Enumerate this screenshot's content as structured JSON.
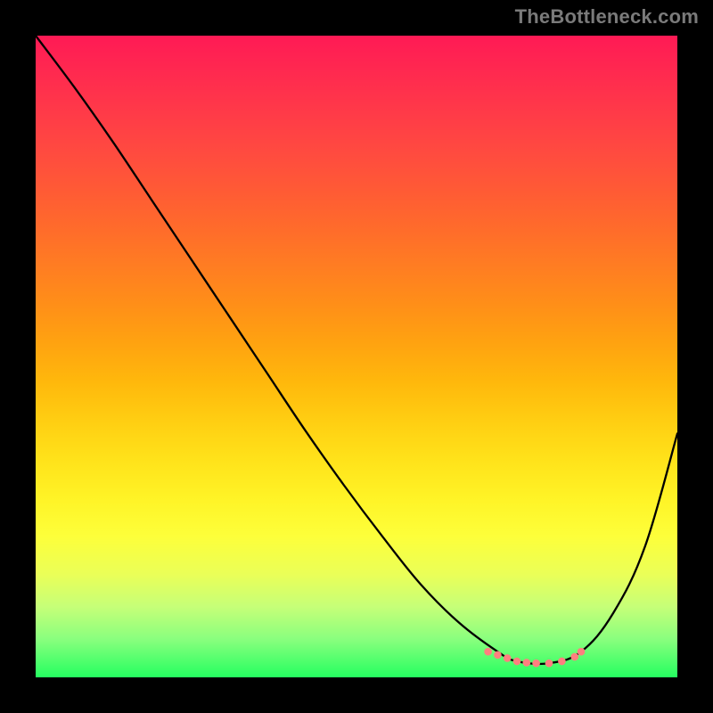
{
  "watermark": "TheBottleneck.com",
  "chart_data": {
    "type": "line",
    "title": "",
    "xlabel": "",
    "ylabel": "",
    "xlim": [
      0,
      1000
    ],
    "ylim": [
      0,
      1000
    ],
    "notes": "Axes are unlabeled; values are normalized 0–1000 positions within the plot area. Y is inverted (0 = top, 1000 = bottom). Curve is a black V-shaped bottleneck line reaching a flat minimum near the bottom-right with small pink marker dots.",
    "series": [
      {
        "name": "bottleneck-curve",
        "color": "#000000",
        "x": [
          0,
          60,
          120,
          180,
          240,
          300,
          360,
          420,
          480,
          540,
          600,
          660,
          720,
          750,
          800,
          850,
          900,
          950,
          1000
        ],
        "y": [
          0,
          80,
          165,
          255,
          345,
          435,
          525,
          615,
          700,
          780,
          855,
          915,
          960,
          975,
          978,
          960,
          900,
          795,
          620
        ]
      }
    ],
    "markers": {
      "name": "trough-dots",
      "color": "#ff7f7f",
      "radius": 6,
      "x": [
        705,
        720,
        735,
        750,
        765,
        780,
        800,
        820,
        840,
        850
      ],
      "y": [
        960,
        965,
        970,
        975,
        977,
        978,
        978,
        975,
        968,
        960
      ]
    }
  }
}
